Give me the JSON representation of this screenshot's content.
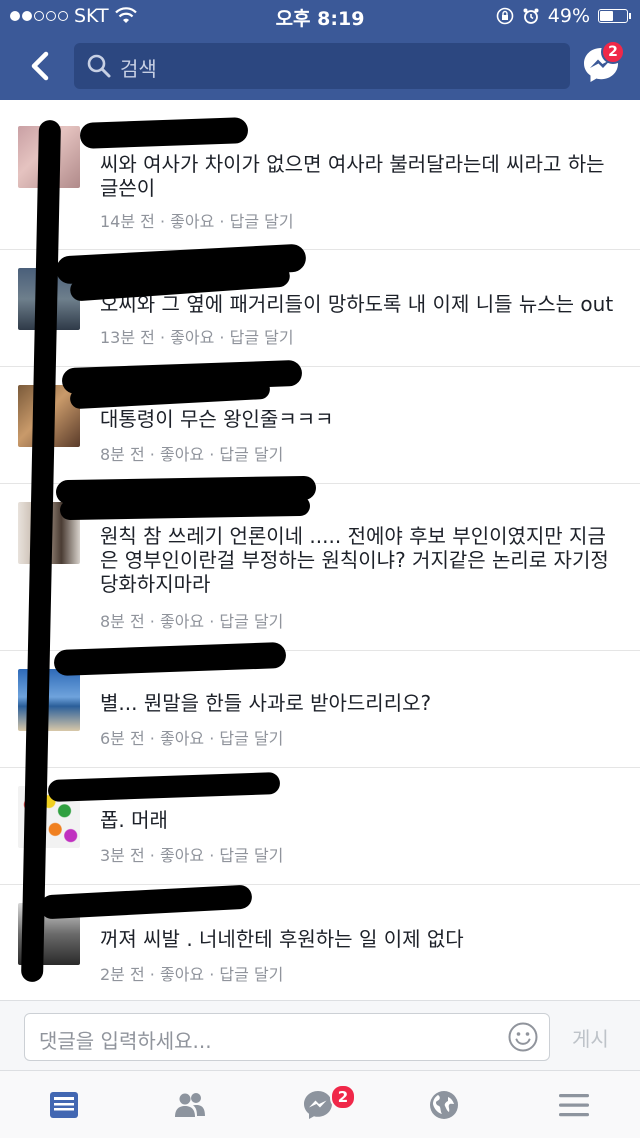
{
  "status_bar": {
    "carrier": "SKT",
    "time": "오후 8:19",
    "battery_percent": "49%",
    "battery_level": 0.49
  },
  "search": {
    "placeholder": "검색"
  },
  "header": {
    "messenger_badge": "2"
  },
  "comments": [
    {
      "text": "씨와 여사가 차이가 없으면 여사라 불러달라는데 씨라고 하는 글쓴이",
      "time": "14분 전",
      "like": "좋아요",
      "reply": "답글 달기"
    },
    {
      "text": "오씨와 그 옆에 패거리들이 망하도록 내 이제 니들 뉴스는 out",
      "time": "13분 전",
      "like": "좋아요",
      "reply": "답글 달기"
    },
    {
      "text": "대통령이 무슨 왕인줄ㅋㅋㅋ",
      "time": "8분 전",
      "like": "좋아요",
      "reply": "답글 달기"
    },
    {
      "text": "원칙 참 쓰레기 언론이네 ..... 전에야 후보 부인이였지만 지금은 영부인이란걸 부정하는 원칙이냐? 거지같은 논리로 자기정당화하지마라",
      "time": "8분 전",
      "like": "좋아요",
      "reply": "답글 달기"
    },
    {
      "text": "별... 뭔말을 한들 사과로 받아드리리오?",
      "time": "6분 전",
      "like": "좋아요",
      "reply": "답글 달기"
    },
    {
      "text": "폽. 머래",
      "time": "3분 전",
      "like": "좋아요",
      "reply": "답글 달기"
    },
    {
      "text": "꺼져 씨발 . 너네한테 후원하는 일 이제 없다",
      "time": "2분 전",
      "like": "좋아요",
      "reply": "답글 달기"
    }
  ],
  "composer": {
    "placeholder": "댓글을 입력하세요...",
    "post_label": "게시"
  },
  "tabbar": {
    "messenger_badge": "2"
  },
  "colors": {
    "brand": "#3b5998",
    "badge": "#f02849",
    "active_tab": "#4267b2",
    "inactive_tab": "#8d949e"
  },
  "icons": [
    "back-chevron-icon",
    "search-icon",
    "messenger-icon",
    "smiley-icon",
    "news-feed-icon",
    "friends-icon",
    "messenger-tab-icon",
    "globe-icon",
    "menu-icon"
  ]
}
